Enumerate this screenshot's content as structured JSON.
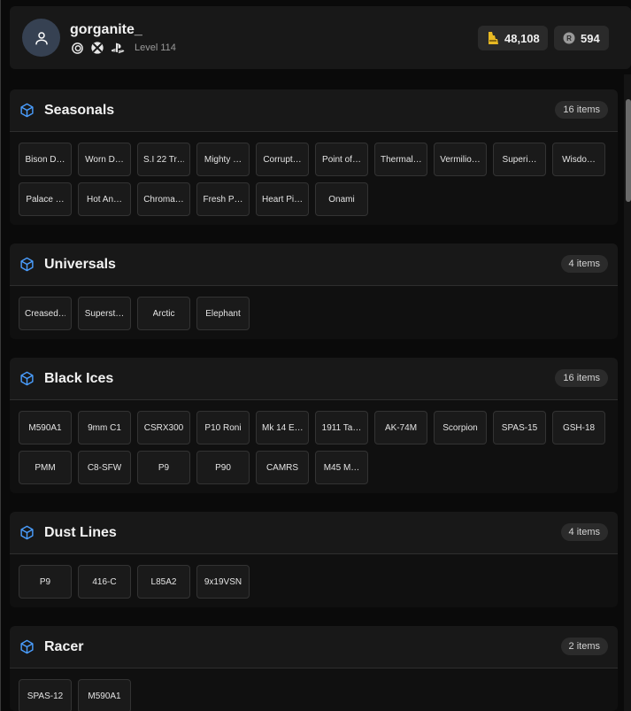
{
  "profile": {
    "username": "gorganite_",
    "level": "Level 114",
    "platforms": [
      "ubisoft-icon",
      "xbox-icon",
      "playstation-icon"
    ]
  },
  "currency": {
    "renown": {
      "value": "48,108",
      "icon": "renown-icon",
      "color": "#e8b923"
    },
    "credits": {
      "value": "594",
      "icon": "r6-credits-icon"
    }
  },
  "sections": [
    {
      "title": "Seasonals",
      "count": "16 items",
      "items": [
        "Bison D…",
        "Worn D…",
        "S.I 22 Tr…",
        "Mighty …",
        "Corrupt…",
        "Point of…",
        "Thermal…",
        "Vermilio…",
        "Superi…",
        "Wisdo…",
        "Palace …",
        "Hot An…",
        "Chroma…",
        "Fresh P…",
        "Heart Pi…",
        "Onami"
      ]
    },
    {
      "title": "Universals",
      "count": "4 items",
      "items": [
        "Creased…",
        "Superst…",
        "Arctic",
        "Elephant"
      ]
    },
    {
      "title": "Black Ices",
      "count": "16 items",
      "items": [
        "M590A1",
        "9mm C1",
        "CSRX300",
        "P10 Roni",
        "Mk 14 E…",
        "1911 Ta…",
        "AK-74M",
        "Scorpion",
        "SPAS-15",
        "GSH-18",
        "PMM",
        "C8-SFW",
        "P9",
        "P90",
        "CAMRS",
        "M45 M…"
      ]
    },
    {
      "title": "Dust Lines",
      "count": "4 items",
      "items": [
        "P9",
        "416-C",
        "L85A2",
        "9x19VSN"
      ]
    },
    {
      "title": "Racer",
      "count": "2 items",
      "items": [
        "SPAS-12",
        "M590A1"
      ]
    }
  ],
  "colors": {
    "accent": "#4a9eff",
    "background": "#0a0a0a",
    "card": "#181818",
    "chip": "#1a1a1a"
  }
}
